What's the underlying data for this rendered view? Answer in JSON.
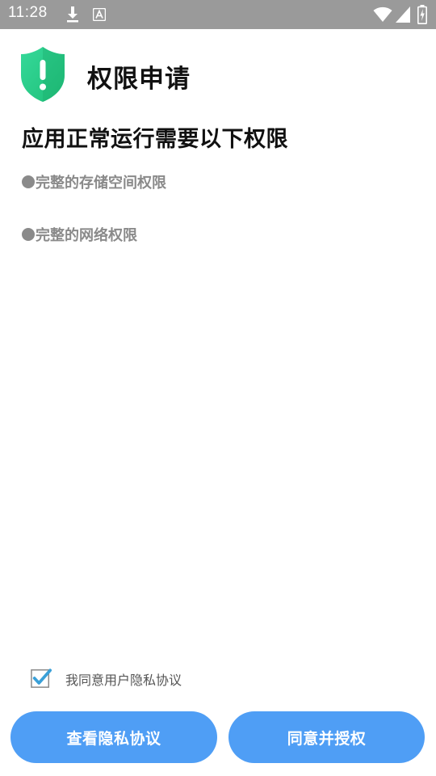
{
  "status_bar": {
    "time": "11:28",
    "icons": [
      "download-icon",
      "font-a-icon",
      "wifi-icon",
      "signal-icon",
      "battery-charging-icon"
    ],
    "background": "#9a9a9a"
  },
  "header": {
    "icon": "shield-exclamation-icon",
    "title": "权限申请",
    "icon_color": "#2ecc8a"
  },
  "main": {
    "subtitle": "应用正常运行需要以下权限",
    "permissions": [
      {
        "label": "完整的存储空间权限"
      },
      {
        "label": "完整的网络权限"
      }
    ]
  },
  "agreement": {
    "checked": true,
    "label": "我同意用户隐私协议"
  },
  "buttons": {
    "view_privacy": "查看隐私协议",
    "agree_authorize": "同意并授权",
    "color": "#4f9ef5"
  }
}
